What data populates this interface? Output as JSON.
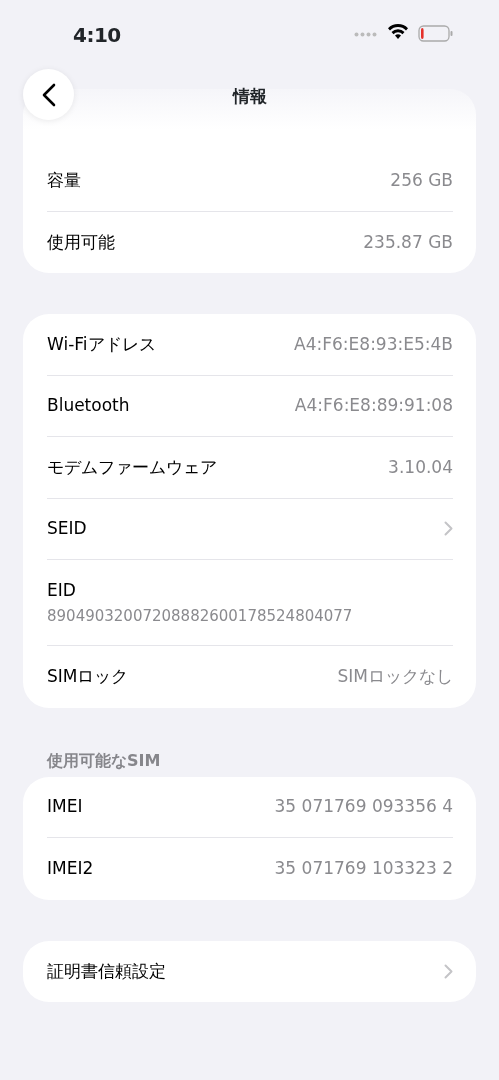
{
  "status_bar": {
    "time": "4:10"
  },
  "nav": {
    "title": "情報"
  },
  "groups": [
    {
      "rows": [
        {
          "kind": "value",
          "label": "容量",
          "value": "256 GB"
        },
        {
          "kind": "value",
          "label": "使用可能",
          "value": "235.87 GB"
        }
      ]
    },
    {
      "rows": [
        {
          "kind": "value",
          "label": "Wi-Fiアドレス",
          "value": "A4:F6:E8:93:E5:4B"
        },
        {
          "kind": "value",
          "label": "Bluetooth",
          "value": "A4:F6:E8:89:91:08"
        },
        {
          "kind": "value",
          "label": "モデムファームウェア",
          "value": "3.10.04"
        },
        {
          "kind": "link",
          "label": "SEID"
        },
        {
          "kind": "stacked",
          "label": "EID",
          "value": "89049032007208882600178524804077"
        },
        {
          "kind": "value",
          "label": "SIMロック",
          "value": "SIMロックなし"
        }
      ]
    },
    {
      "header": "使用可能なSIM",
      "rows": [
        {
          "kind": "value",
          "label": "IMEI",
          "value": "35 071769 093356 4"
        },
        {
          "kind": "value",
          "label": "IMEI2",
          "value": "35 071769 103323 2"
        }
      ]
    },
    {
      "rows": [
        {
          "kind": "link",
          "label": "証明書信頼設定"
        }
      ]
    }
  ]
}
